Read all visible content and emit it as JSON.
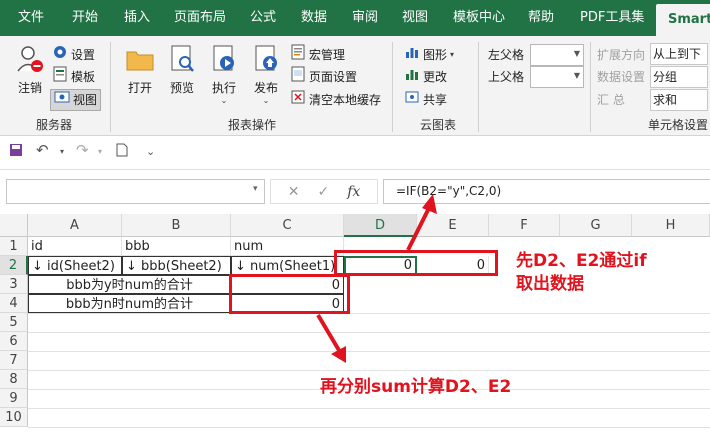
{
  "menu_tabs": [
    "文件",
    "开始",
    "插入",
    "页面布局",
    "公式",
    "数据",
    "审阅",
    "视图",
    "模板中心",
    "帮助",
    "PDF工具集",
    "Smartbi"
  ],
  "ribbon": {
    "server": {
      "logout": "注销",
      "settings": "设置",
      "template": "模板",
      "view": "视图",
      "label": "服务器"
    },
    "report": {
      "open": "打开",
      "preview": "预览",
      "execute": "执行",
      "publish": "发布",
      "macro": "宏管理",
      "page_setup": "页面设置",
      "clear_cache": "清空本地缓存",
      "label": "报表操作"
    },
    "cloud": {
      "chart": "图形",
      "more": "更改",
      "share": "共享",
      "label": "云图表"
    },
    "parent": {
      "left": "左父格",
      "top": "上父格"
    },
    "cell_setting": {
      "expand_dir": "扩展方向",
      "expand_val": "从上到下",
      "data_setting": "数据设置",
      "data_val": "分组",
      "summary": "汇  总",
      "summary_val": "求和",
      "label": "单元格设置"
    }
  },
  "formula_bar": {
    "name_box": "",
    "formula": "=IF(B2=\"y\",C2,0)",
    "fx": "fx"
  },
  "grid": {
    "columns": [
      "A",
      "B",
      "C",
      "D",
      "E",
      "F",
      "G",
      "H"
    ],
    "rows": [
      "1",
      "2",
      "3",
      "4",
      "5",
      "6",
      "7",
      "8",
      "9",
      "10"
    ],
    "cells": {
      "A1": "id",
      "B1": "bbb",
      "C1": "num",
      "A2": "↓ id(Sheet2)",
      "B2": "↓ bbb(Sheet2)",
      "C2": "↓ num(Sheet1)",
      "D2": "0",
      "E2": "0",
      "AB3": "bbb为y时num的合计",
      "C3": "0",
      "AB4": "bbb为n时num的合计",
      "C4": "0"
    }
  },
  "annotations": {
    "note1_line1": "先D2、E2通过if",
    "note1_line2": "取出数据",
    "note2": "再分别sum计算D2、E2"
  }
}
